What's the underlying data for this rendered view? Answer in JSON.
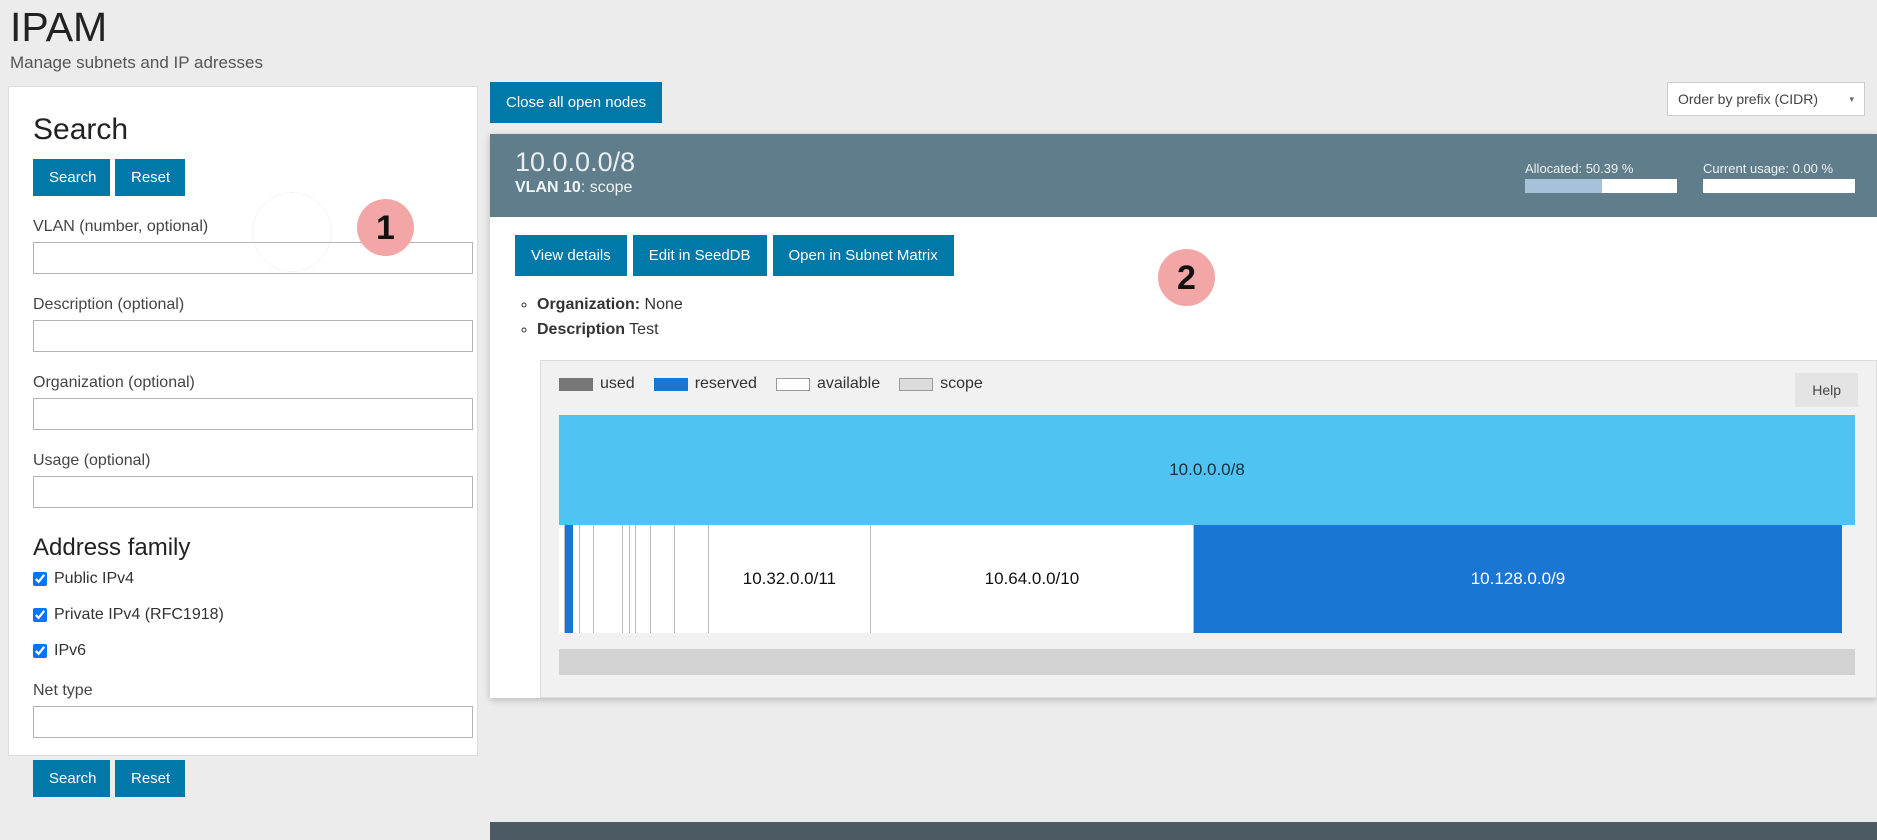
{
  "header": {
    "title": "IPAM",
    "subtitle": "Manage subnets and IP adresses"
  },
  "badges": {
    "one": "1",
    "two": "2"
  },
  "search_panel": {
    "heading": "Search",
    "top_search_label": "Search",
    "top_reset_label": "Reset",
    "fields": [
      {
        "label": "VLAN (number, optional)",
        "value": "",
        "placeholder": ""
      },
      {
        "label": "Description (optional)",
        "value": "",
        "placeholder": ""
      },
      {
        "label": "Organization (optional)",
        "value": "",
        "placeholder": ""
      },
      {
        "label": "Usage (optional)",
        "value": "",
        "placeholder": ""
      }
    ],
    "address_family_heading": "Address family",
    "address_family": [
      {
        "label": "Public IPv4",
        "checked": true
      },
      {
        "label": "Private IPv4 (RFC1918)",
        "checked": true
      },
      {
        "label": "IPv6",
        "checked": true
      }
    ],
    "net_type_label": "Net type",
    "net_type_value": "",
    "bottom_search_label": "Search",
    "bottom_reset_label": "Reset"
  },
  "toolbar": {
    "close_nodes_label": "Close all open nodes",
    "order_select_value": "Order by prefix (CIDR)",
    "order_select_caret": "▾"
  },
  "node": {
    "cidr": "10.0.0.0/8",
    "vlan_prefix": "VLAN 10",
    "vlan_suffix": ": scope",
    "allocated_label": "Allocated: 50.39 %",
    "allocated_pct": 50.39,
    "usage_label": "Current usage: 0.00 %",
    "usage_pct": 0.0,
    "actions": [
      "View details",
      "Edit in SeedDB",
      "Open in Subnet Matrix"
    ],
    "meta": [
      {
        "key": "Organization:",
        "value": "None"
      },
      {
        "key": "Description",
        "value": "Test"
      }
    ]
  },
  "chart": {
    "help_label": "Help",
    "legend": [
      {
        "name": "used",
        "color": "#777777",
        "swatch": "sw-used"
      },
      {
        "name": "reserved",
        "color": "#1976d2",
        "swatch": "sw-reserved"
      },
      {
        "name": "available",
        "color": "#ffffff",
        "swatch": "sw-available"
      },
      {
        "name": "scope",
        "color": "#dcdcdc",
        "swatch": "sw-scope"
      }
    ]
  },
  "chart_data": {
    "type": "treemap",
    "title": "Subnet allocation map for 10.0.0.0/8",
    "colors": {
      "scope": "#4fc3f2",
      "reserved": "#1976d2",
      "available": "#ffffff",
      "used": "#777777",
      "border": "#bdbdbd"
    },
    "rows": [
      {
        "name": "scope-row",
        "segments": [
          {
            "label": "10.0.0.0/8",
            "kind": "scope",
            "width_pct": 100.0,
            "show_label": true
          }
        ]
      },
      {
        "name": "children-row",
        "segments": [
          {
            "label": "",
            "kind": "available",
            "width_pct": 0.45,
            "show_label": false
          },
          {
            "label": "",
            "kind": "reserved",
            "width_pct": 0.62,
            "show_label": false
          },
          {
            "label": "",
            "kind": "available",
            "width_pct": 0.55,
            "show_label": false
          },
          {
            "label": "",
            "kind": "available",
            "width_pct": 1.1,
            "show_label": false
          },
          {
            "label": "",
            "kind": "available",
            "width_pct": 2.2,
            "show_label": false
          },
          {
            "label": "",
            "kind": "available",
            "width_pct": 0.55,
            "show_label": false
          },
          {
            "label": "",
            "kind": "available",
            "width_pct": 0.5,
            "show_label": false
          },
          {
            "label": "",
            "kind": "available",
            "width_pct": 1.1,
            "show_label": false
          },
          {
            "label": "",
            "kind": "available",
            "width_pct": 1.9,
            "show_label": false
          },
          {
            "label": "",
            "kind": "available",
            "width_pct": 2.6,
            "show_label": false
          },
          {
            "label": "10.32.0.0/11",
            "kind": "available",
            "width_pct": 12.5,
            "show_label": true
          },
          {
            "label": "10.64.0.0/10",
            "kind": "available",
            "width_pct": 24.93,
            "show_label": true
          },
          {
            "label": "10.128.0.0/9",
            "kind": "reserved",
            "width_pct": 50.0,
            "show_label": true
          }
        ]
      }
    ]
  },
  "scrollbar": {
    "name": "horizontal-scroll-track"
  }
}
